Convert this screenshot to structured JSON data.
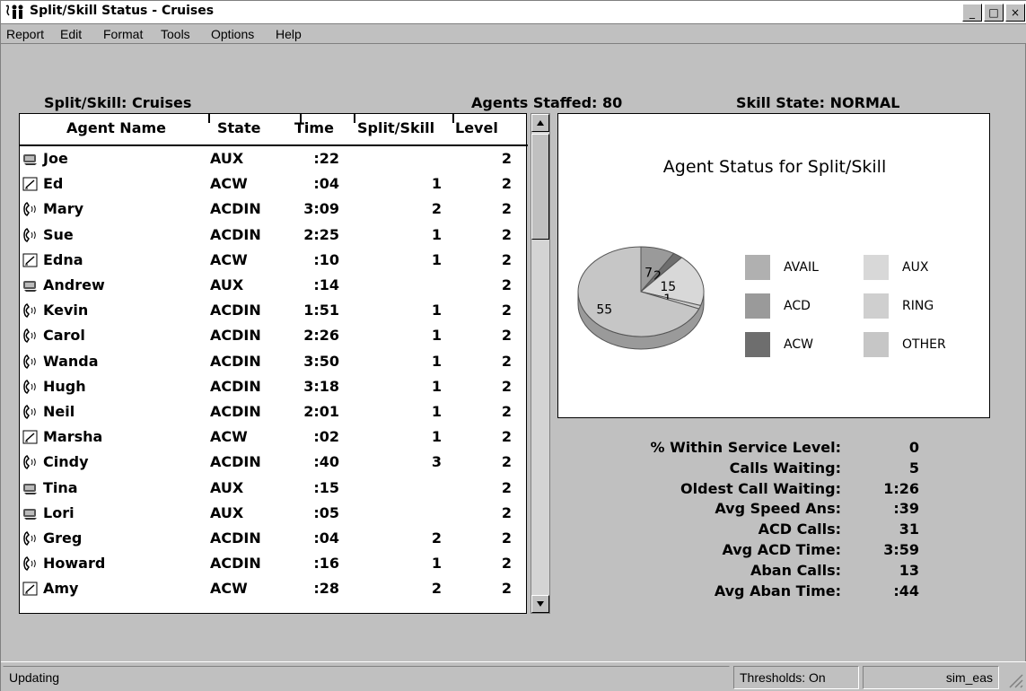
{
  "window": {
    "title": "Split/Skill Status - Cruises",
    "minimize_label": "_",
    "maximize_label": "□",
    "close_label": "×"
  },
  "menu": [
    {
      "label": "Report"
    },
    {
      "label": "Edit"
    },
    {
      "label": "Format"
    },
    {
      "label": "Tools"
    },
    {
      "label": "Options"
    },
    {
      "label": "Help"
    }
  ],
  "summary": {
    "split_skill": "Split/Skill:  Cruises",
    "agents_staffed": "Agents Staffed: 80",
    "skill_state": "Skill State:  NORMAL"
  },
  "table": {
    "columns": [
      "Agent Name",
      "State",
      "Time",
      "Split/Skill",
      "Level"
    ],
    "rows": [
      {
        "icon": "aux",
        "name": "Joe",
        "state": "AUX",
        "time": ":22",
        "split": "",
        "level": "2"
      },
      {
        "icon": "acw",
        "name": "Ed",
        "state": "ACW",
        "time": ":04",
        "split": "1",
        "level": "2"
      },
      {
        "icon": "phone",
        "name": "Mary",
        "state": "ACDIN",
        "time": "3:09",
        "split": "2",
        "level": "2"
      },
      {
        "icon": "phone",
        "name": "Sue",
        "state": "ACDIN",
        "time": "2:25",
        "split": "1",
        "level": "2"
      },
      {
        "icon": "acw",
        "name": "Edna",
        "state": "ACW",
        "time": ":10",
        "split": "1",
        "level": "2"
      },
      {
        "icon": "aux",
        "name": "Andrew",
        "state": "AUX",
        "time": ":14",
        "split": "",
        "level": "2"
      },
      {
        "icon": "phone",
        "name": "Kevin",
        "state": "ACDIN",
        "time": "1:51",
        "split": "1",
        "level": "2"
      },
      {
        "icon": "phone",
        "name": "Carol",
        "state": "ACDIN",
        "time": "2:26",
        "split": "1",
        "level": "2"
      },
      {
        "icon": "phone",
        "name": "Wanda",
        "state": "ACDIN",
        "time": "3:50",
        "split": "1",
        "level": "2"
      },
      {
        "icon": "phone",
        "name": "Hugh",
        "state": "ACDIN",
        "time": "3:18",
        "split": "1",
        "level": "2"
      },
      {
        "icon": "phone",
        "name": "Neil",
        "state": "ACDIN",
        "time": "2:01",
        "split": "1",
        "level": "2"
      },
      {
        "icon": "acw",
        "name": "Marsha",
        "state": "ACW",
        "time": ":02",
        "split": "1",
        "level": "2"
      },
      {
        "icon": "phone",
        "name": "Cindy",
        "state": "ACDIN",
        "time": ":40",
        "split": "3",
        "level": "2"
      },
      {
        "icon": "aux",
        "name": "Tina",
        "state": "AUX",
        "time": ":15",
        "split": "",
        "level": "2"
      },
      {
        "icon": "aux",
        "name": "Lori",
        "state": "AUX",
        "time": ":05",
        "split": "",
        "level": "2"
      },
      {
        "icon": "phone",
        "name": "Greg",
        "state": "ACDIN",
        "time": ":04",
        "split": "2",
        "level": "2"
      },
      {
        "icon": "phone",
        "name": "Howard",
        "state": "ACDIN",
        "time": ":16",
        "split": "1",
        "level": "2"
      },
      {
        "icon": "acw",
        "name": "Amy",
        "state": "ACW",
        "time": ":28",
        "split": "2",
        "level": "2"
      }
    ]
  },
  "chart_data": {
    "type": "pie",
    "title": "Agent Status for Split/Skill",
    "slices": [
      {
        "label": "ACD",
        "value": 7,
        "color": "#9a9a9a"
      },
      {
        "label": "ACW",
        "value": 2,
        "color": "#6e6e6e"
      },
      {
        "label": "AUX",
        "value": 15,
        "color": "#d8d8d8"
      },
      {
        "label": "RING",
        "value": 1,
        "color": "#cfcfcf"
      },
      {
        "label": "AVAIL",
        "value": 55,
        "color": "#c6c6c6"
      }
    ],
    "legend": [
      {
        "label": "AVAIL",
        "color": "#b0b0b0"
      },
      {
        "label": "AUX",
        "color": "#d8d8d8"
      },
      {
        "label": "ACD",
        "color": "#9a9a9a"
      },
      {
        "label": "RING",
        "color": "#cfcfcf"
      },
      {
        "label": "ACW",
        "color": "#6e6e6e"
      },
      {
        "label": "OTHER",
        "color": "#c6c6c6"
      }
    ],
    "legend_placement": "right"
  },
  "stats": [
    {
      "label": "% Within Service Level:",
      "value": "0"
    },
    {
      "label": "Calls Waiting:",
      "value": "5"
    },
    {
      "label": "Oldest Call Waiting:",
      "value": "1:26"
    },
    {
      "label": "Avg Speed Ans:",
      "value": ":39"
    },
    {
      "label": "ACD Calls:",
      "value": "31"
    },
    {
      "label": "Avg ACD Time:",
      "value": "3:59"
    },
    {
      "label": "Aban Calls:",
      "value": "13"
    },
    {
      "label": "Avg Aban Time:",
      "value": ":44"
    }
  ],
  "statusbar": {
    "status": "Updating",
    "thresholds": "Thresholds: On",
    "server": "sim_eas"
  }
}
